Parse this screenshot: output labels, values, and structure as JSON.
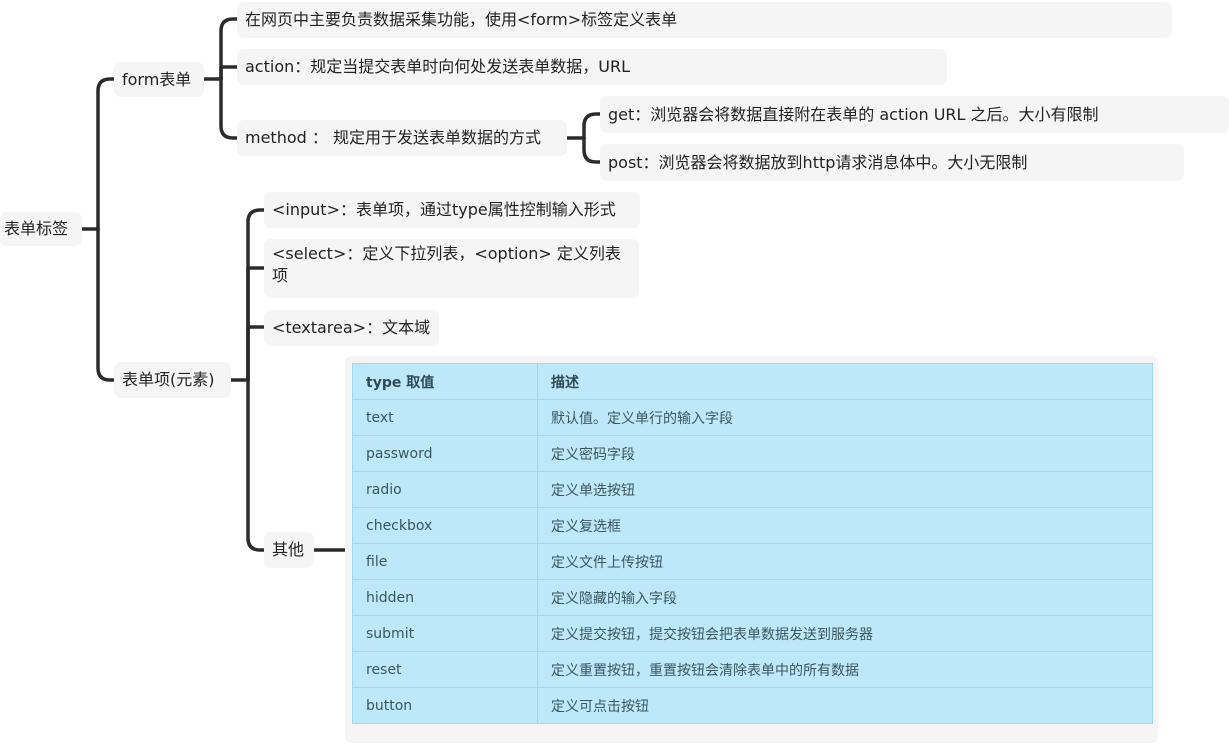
{
  "mindmap": {
    "root": {
      "label": "表单标签"
    },
    "form": {
      "label": "form表单",
      "children": [
        {
          "label": "在网页中主要负责数据采集功能，使用<form>标签定义表单"
        },
        {
          "label": "action：规定当提交表单时向何处发送表单数据，URL"
        },
        {
          "label": "method ： 规定用于发送表单数据的方式",
          "children": [
            {
              "label": "get：浏览器会将数据直接附在表单的 action URL 之后。大小有限制"
            },
            {
              "label": "post：浏览器会将数据放到http请求消息体中。大小无限制"
            }
          ]
        }
      ]
    },
    "items": {
      "label": "表单项(元素)",
      "children": [
        {
          "label": "<input>：表单项，通过type属性控制输入形式"
        },
        {
          "label": "<select>：定义下拉列表，<option> 定义列表项"
        },
        {
          "label": "<textarea>：文本域"
        },
        {
          "label": "其他"
        }
      ]
    }
  },
  "type_table": {
    "headers": [
      "type 取值",
      "描述"
    ],
    "rows": [
      [
        "text",
        "默认值。定义单行的输入字段"
      ],
      [
        "password",
        "定义密码字段"
      ],
      [
        "radio",
        "定义单选按钮"
      ],
      [
        "checkbox",
        "定义复选框"
      ],
      [
        "file",
        "定义文件上传按钮"
      ],
      [
        "hidden",
        "定义隐藏的输入字段"
      ],
      [
        "submit",
        "定义提交按钮，提交按钮会把表单数据发送到服务器"
      ],
      [
        "reset",
        "定义重置按钮，重置按钮会清除表单中的所有数据"
      ],
      [
        "button",
        "定义可点击按钮"
      ]
    ]
  },
  "colors": {
    "connector": "#2b2b2b",
    "node_bg": "#f5f5f5",
    "table_bg": "#bde8f9",
    "table_border": "#5ec9f2"
  }
}
